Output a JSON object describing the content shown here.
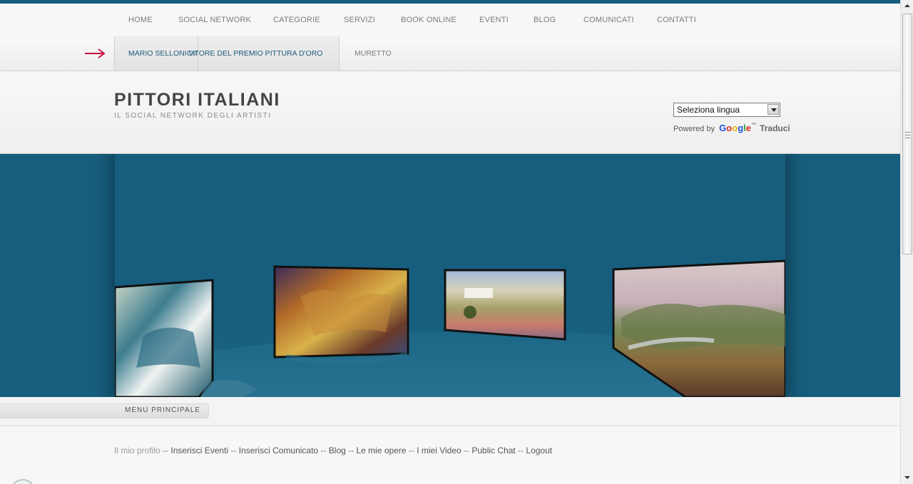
{
  "nav_primary": {
    "items": [
      "HOME",
      "SOCIAL NETWORK",
      "CATEGORIE",
      "SERVIZI",
      "BOOK ONLINE",
      "EVENTI",
      "BLOG",
      "COMUNICATI",
      "CONTATTI"
    ]
  },
  "nav_secondary": {
    "active_tab_a": "MARIO SELLONI VIN",
    "active_tab_b": "CITORE DEL PREMIO PITTURA D'ORO",
    "tab_muretto": "MURETTO",
    "arrow_icon": "arrow-right-icon",
    "arrow_color": "#c8103e"
  },
  "header": {
    "title": "PITTORI ITALIANI",
    "subtitle": "IL SOCIAL NETWORK DEGLI ARTISTI"
  },
  "translate": {
    "select_value": "Seleziona lingua",
    "powered_by": "Powered by",
    "google": "Google",
    "tm": "™",
    "traduci": "Traduci"
  },
  "banner": {
    "background_color": "#175e7e"
  },
  "menu": {
    "label": "MENU PRINCIPALE"
  },
  "user_links": {
    "first": "Il mio profilo",
    "separator": " -- ",
    "items": [
      "Inserisci Eventi",
      "Inserisci Comunicato",
      "Blog",
      "Le mie opere",
      "I miei Video",
      "Public Chat",
      "Logout"
    ]
  },
  "colors": {
    "accent": "#175e7e",
    "active_link": "#1c5a7a"
  }
}
